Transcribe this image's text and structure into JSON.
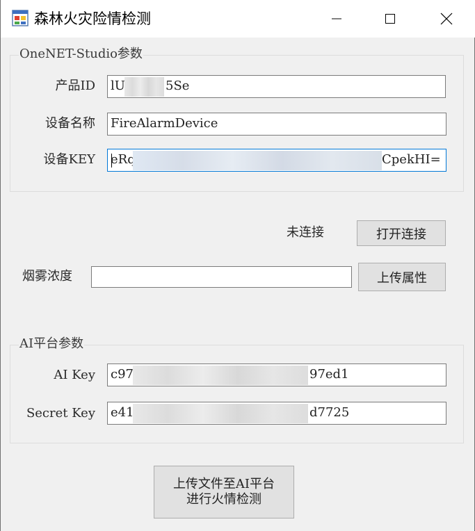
{
  "window": {
    "title": "森林火灾险情检测",
    "icon": "winforms-app-icon"
  },
  "onenet": {
    "group_title": "OneNET-Studio参数",
    "product_id_label": "产品ID",
    "product_id_value": "lU",
    "product_id_suffix": "5Se",
    "device_name_label": "设备名称",
    "device_name_value": "FireAlarmDevice",
    "device_key_label": "设备KEY",
    "device_key_value": "eRq",
    "device_key_suffix": "CpekHI="
  },
  "connection": {
    "status": "未连接",
    "open_button": "打开连接"
  },
  "smoke": {
    "label": "烟雾浓度",
    "value": "",
    "upload_button": "上传属性"
  },
  "ai": {
    "group_title": "AI平台参数",
    "ai_key_label": "AI Key",
    "ai_key_value": "c97",
    "ai_key_suffix": "97ed1",
    "secret_key_label": "Secret Key",
    "secret_key_value": "e41",
    "secret_key_suffix": "d7725"
  },
  "detect_button": {
    "line1": "上传文件至AI平台",
    "line2": "进行火情检测"
  },
  "colors": {
    "focus_border": "#0078d7",
    "button_face": "#e1e1e1",
    "window_bg": "#f0f0f0"
  }
}
